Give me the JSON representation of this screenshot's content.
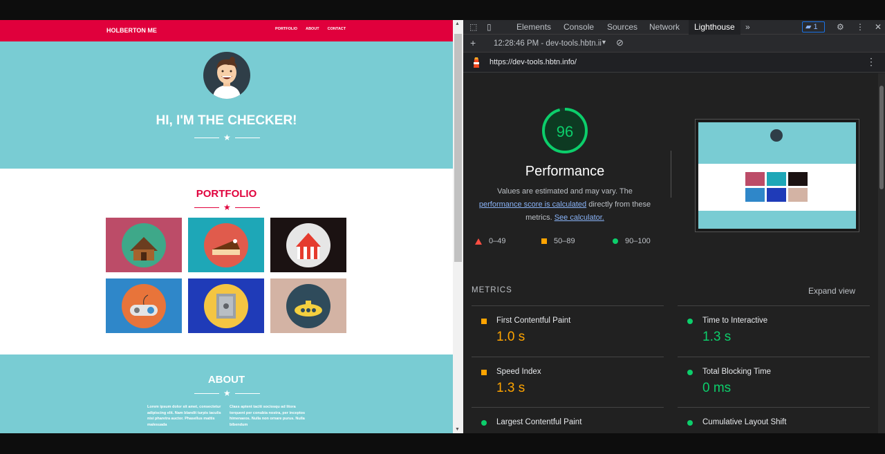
{
  "website": {
    "nav": {
      "brand": "HOLBERTON ME",
      "links": [
        "PORTFOLIO",
        "ABOUT",
        "CONTACT"
      ]
    },
    "hero": {
      "title": "HI, I'M THE CHECKER!"
    },
    "portfolio": {
      "title": "PORTFOLIO",
      "tiles": [
        {
          "icon": "cabin-icon",
          "bg": "#bc4c68",
          "circle": "#3ea889"
        },
        {
          "icon": "cake-icon",
          "bg": "#1ea7b7",
          "circle": "#e05b4c"
        },
        {
          "icon": "circus-tent-icon",
          "bg": "#1b1212",
          "circle": "#e6e6e6"
        },
        {
          "icon": "game-controller-icon",
          "bg": "#2f87c9",
          "circle": "#e8743a"
        },
        {
          "icon": "safe-icon",
          "bg": "#1f3bb8",
          "circle": "#f4c542"
        },
        {
          "icon": "submarine-icon",
          "bg": "#d3b3a4",
          "circle": "#2f4b5b"
        }
      ]
    },
    "about": {
      "title": "ABOUT",
      "col1": "Lorem ipsum dolor sit amet, consectetur adipiscing elit. Nam blandit turpis iaculis nisi pharetra auctor. Phasellus mattis malesuada",
      "col2": "Class aptent taciti sociosqu ad litora torquent per conubia nostra, per inceptos himenaeos. Nulla non ornare purus. Nulla bibendum"
    }
  },
  "devtools": {
    "tabs": [
      "Elements",
      "Console",
      "Sources",
      "Network",
      "Lighthouse"
    ],
    "active_tab": "Lighthouse",
    "issues_count": "1",
    "report_selector": "12:28:46 PM - dev-tools.hbtn.ii",
    "url": "https://dev-tools.hbtn.info/",
    "performance": {
      "score": "96",
      "score_fraction": 0.96,
      "title": "Performance",
      "desc_1": "Values are estimated and may vary. The",
      "desc_link_1": "performance score is calculated",
      "desc_2": "directly from these metrics.",
      "desc_link_2": "See calculator.",
      "legend": [
        "0–49",
        "50–89",
        "90–100"
      ]
    },
    "metrics_label": "METRICS",
    "expand_label": "Expand view",
    "metrics": [
      {
        "name": "First Contentful Paint",
        "value": "1.0 s",
        "status": "average"
      },
      {
        "name": "Time to Interactive",
        "value": "1.3 s",
        "status": "pass"
      },
      {
        "name": "Speed Index",
        "value": "1.3 s",
        "status": "average"
      },
      {
        "name": "Total Blocking Time",
        "value": "0 ms",
        "status": "pass"
      },
      {
        "name": "Largest Contentful Paint",
        "value": "",
        "status": "pass"
      },
      {
        "name": "Cumulative Layout Shift",
        "value": "",
        "status": "pass"
      }
    ],
    "colors": {
      "pass": "#0cce6b",
      "average": "#ffa400",
      "fail": "#ff4e42"
    }
  }
}
